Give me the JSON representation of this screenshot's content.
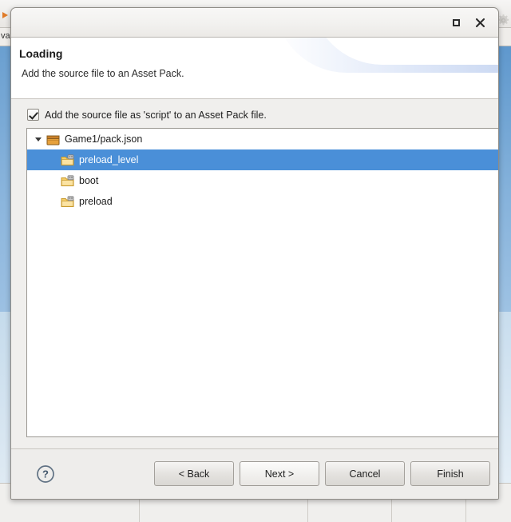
{
  "background": {
    "tab_label": "va",
    "arrow_icon": "orange-arrow-icon",
    "gear_icon": "gear-icon",
    "statusbar_segments": 5
  },
  "dialog": {
    "titlebar": {
      "title": "",
      "maximize_label": "maximize-icon",
      "close_label": "✕"
    },
    "header": {
      "title": "Loading",
      "description": "Add the source file to an Asset Pack."
    },
    "options": {
      "script_checkbox": {
        "label": "Add the source file as 'script' to an Asset Pack file.",
        "checked": true
      }
    },
    "tree": {
      "nodes": [
        {
          "label": "Game1/pack.json",
          "level": 0,
          "icon": "asset-pack-icon",
          "expanded": true,
          "selected": false
        },
        {
          "label": "preload_level",
          "level": 1,
          "icon": "asset-pack-section-icon",
          "expanded": false,
          "selected": true
        },
        {
          "label": "boot",
          "level": 1,
          "icon": "asset-pack-section-icon",
          "expanded": false,
          "selected": false
        },
        {
          "label": "preload",
          "level": 1,
          "icon": "asset-pack-section-icon",
          "expanded": false,
          "selected": false
        }
      ]
    },
    "footer": {
      "help_icon": "help-question-icon",
      "buttons": [
        {
          "label": "< Back",
          "name": "back-button",
          "default": false
        },
        {
          "label": "Next >",
          "name": "next-button",
          "default": true
        },
        {
          "label": "Cancel",
          "name": "cancel-button",
          "default": false
        },
        {
          "label": "Finish",
          "name": "finish-button",
          "default": false
        }
      ]
    }
  },
  "colors": {
    "selection_blue": "#4a8fd8",
    "dialog_bg": "#f0efed",
    "header_bg": "#ffffff",
    "tree_bg": "#ffffff",
    "accent_panel_blue": "#6a9fd0"
  }
}
